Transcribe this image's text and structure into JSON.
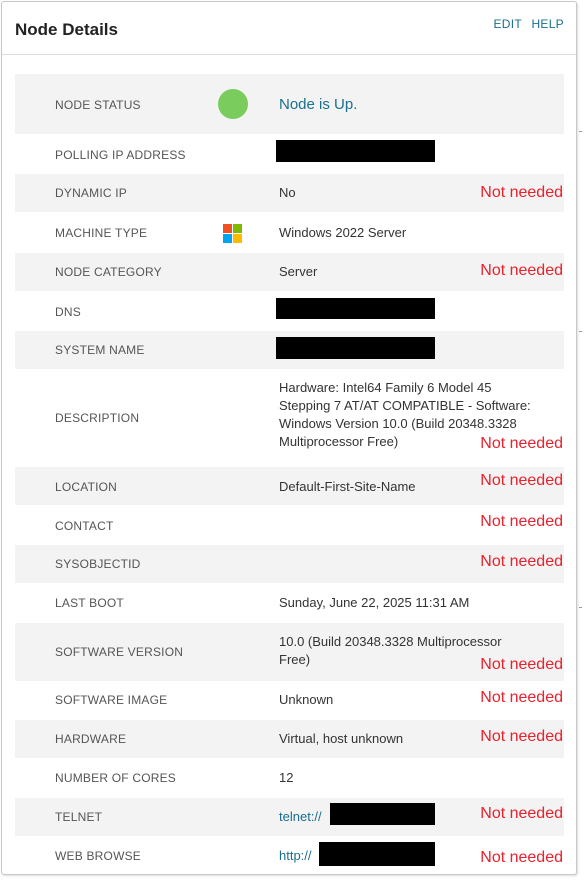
{
  "header": {
    "title": "Node Details",
    "edit_label": "EDIT",
    "help_label": "HELP"
  },
  "rows": {
    "node_status": {
      "label": "NODE STATUS",
      "value": "Node is Up.",
      "status_color": "#7acc5c"
    },
    "polling_ip": {
      "label": "POLLING IP ADDRESS"
    },
    "dynamic_ip": {
      "label": "DYNAMIC IP",
      "value": "No",
      "note": "Not needed"
    },
    "machine_type": {
      "label": "MACHINE TYPE",
      "value": "Windows 2022 Server",
      "icon": "windows-logo-icon"
    },
    "node_category": {
      "label": "NODE CATEGORY",
      "value": "Server",
      "note": "Not needed"
    },
    "dns": {
      "label": "DNS"
    },
    "system_name": {
      "label": "SYSTEM NAME"
    },
    "description": {
      "label": "DESCRIPTION",
      "line1": "Hardware: Intel64 Family 6 Model 45",
      "line2": "Stepping 7 AT/AT COMPATIBLE - Software:",
      "line3": "Windows Version 10.0 (Build 20348.3328",
      "line4": "Multiprocessor Free)",
      "note": "Not needed"
    },
    "location": {
      "label": "LOCATION",
      "value": "Default-First-Site-Name",
      "note": "Not needed"
    },
    "contact": {
      "label": "CONTACT",
      "note": "Not needed"
    },
    "sysobjectid": {
      "label": "SYSOBJECTID",
      "note": "Not needed"
    },
    "last_boot": {
      "label": "LAST BOOT",
      "value": "Sunday, June 22, 2025 11:31 AM"
    },
    "software_version": {
      "label": "SOFTWARE VERSION",
      "line1": "10.0 (Build 20348.3328 Multiprocessor",
      "line2": "Free)",
      "note": "Not needed"
    },
    "software_image": {
      "label": "SOFTWARE IMAGE",
      "value": "Unknown",
      "note": "Not needed"
    },
    "hardware": {
      "label": "HARDWARE",
      "value": "Virtual, host unknown",
      "note": "Not needed"
    },
    "cores": {
      "label": "NUMBER OF CORES",
      "value": "12"
    },
    "telnet": {
      "label": "TELNET",
      "value": "telnet://",
      "note": "Not needed"
    },
    "web_browse": {
      "label": "WEB BROWSE",
      "value": "http://",
      "note": "Not needed"
    }
  },
  "colors": {
    "accent": "#1a6e8e",
    "note": "#e8212d",
    "status_up": "#7acc5c",
    "row_shade": "#f3f3f3"
  }
}
